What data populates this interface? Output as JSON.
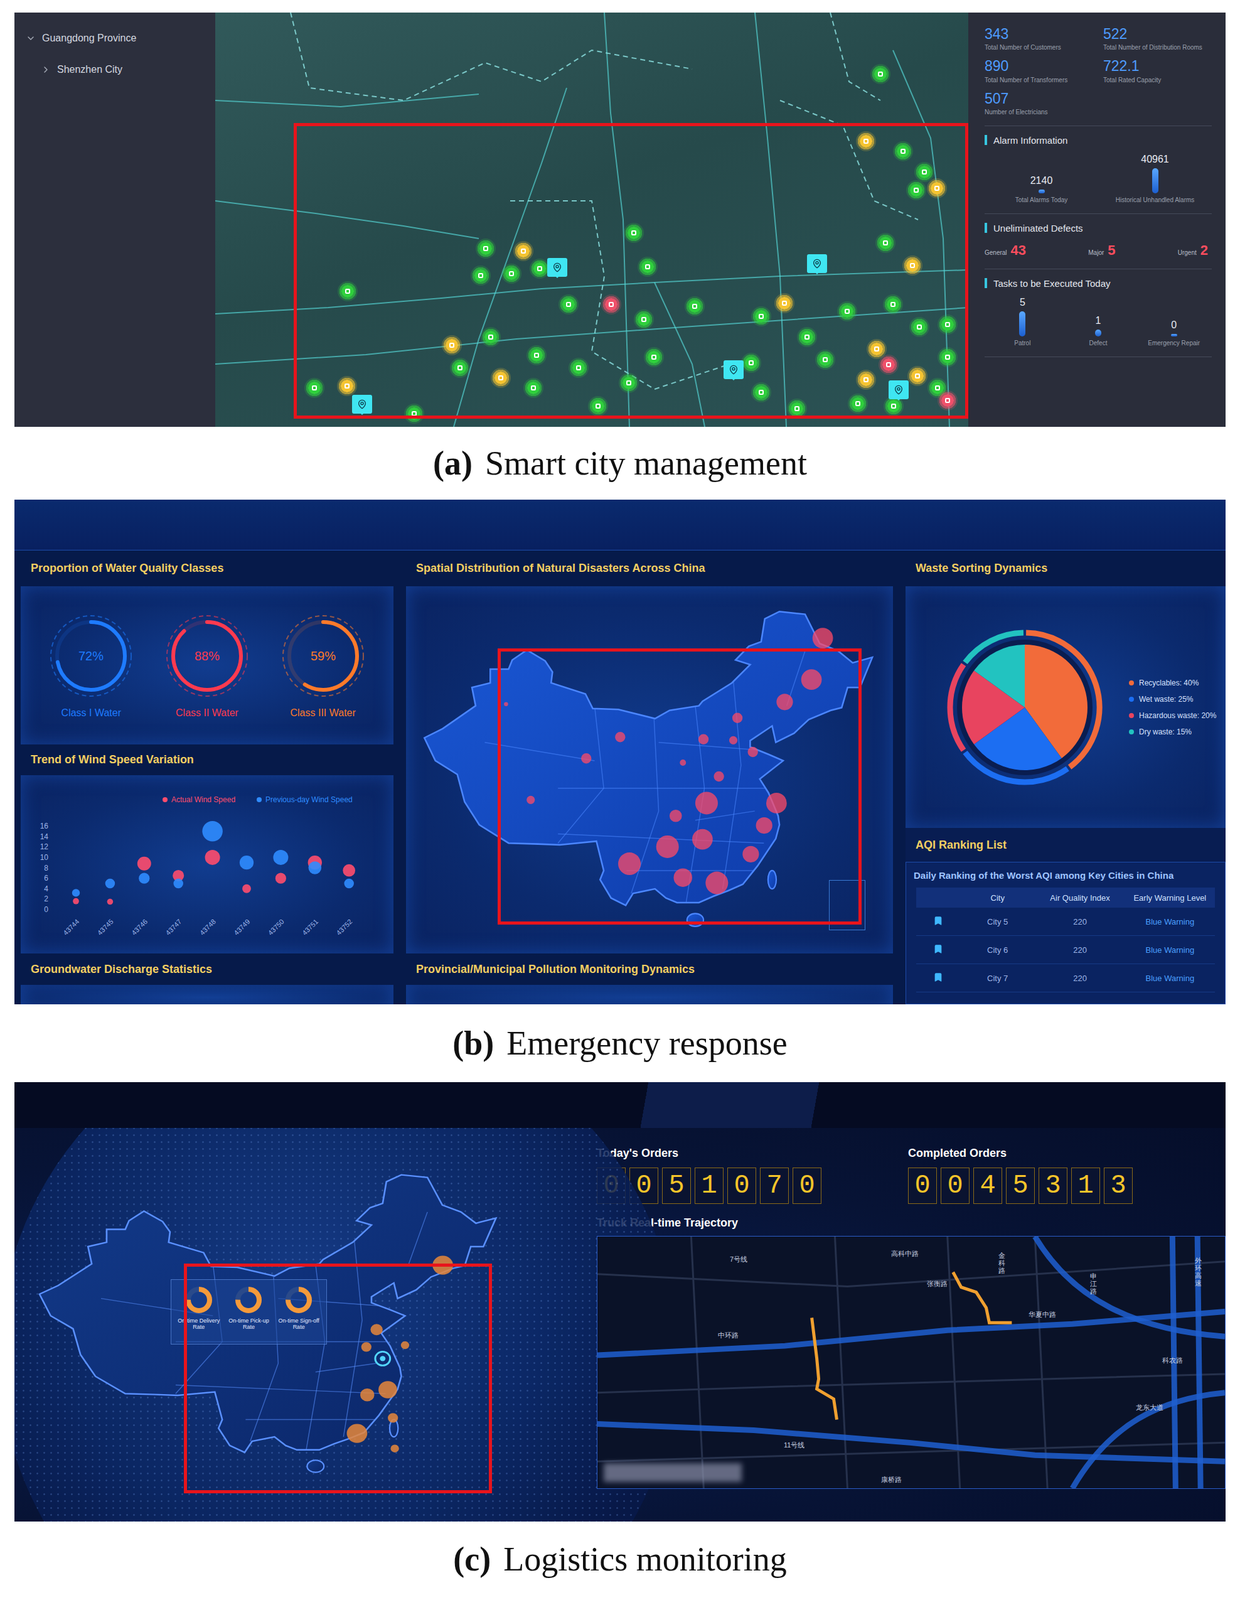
{
  "smart_city": {
    "caption": {
      "label": "(a)",
      "title": "Smart city management"
    },
    "tree": [
      {
        "label": "Guangdong Province",
        "expanded": true,
        "depth": 0
      },
      {
        "label": "Shenzhen City",
        "expanded": false,
        "depth": 1
      }
    ],
    "stats": [
      {
        "value": "343",
        "label": "Total Number of Customers"
      },
      {
        "value": "522",
        "label": "Total Number of Distribution Rooms"
      },
      {
        "value": "890",
        "label": "Total Number of Transformers"
      },
      {
        "value": "722.1",
        "label": "Total Rated Capacity"
      },
      {
        "value": "507",
        "label": "Number of Electricians"
      }
    ],
    "alarms": {
      "title": "Alarm Information",
      "items": [
        {
          "value": "2140",
          "label": "Total Alarms Today",
          "level": 0.05
        },
        {
          "value": "40961",
          "label": "Historical Unhandled Alarms",
          "level": 1
        }
      ]
    },
    "defects": {
      "title": "Uneliminated Defects",
      "items": [
        {
          "label": "General",
          "value": "43"
        },
        {
          "label": "Major",
          "value": "5"
        },
        {
          "label": "Urgent",
          "value": "2"
        }
      ]
    },
    "tasks": {
      "title": "Tasks to be Executed Today",
      "items": [
        {
          "value": "5",
          "label": "Patrol",
          "level": 1
        },
        {
          "value": "1",
          "label": "Defect",
          "level": 0.2
        },
        {
          "value": "0",
          "label": "Emergency Repair",
          "level": 0
        }
      ]
    },
    "markers": [
      {
        "color": "#2fd03c"
      },
      {
        "color": "#2fd03c"
      },
      {
        "color": "#2fd03c"
      },
      {
        "color": "#2fd03c"
      },
      {
        "color": "#2fd03c"
      },
      {
        "color": "#2fd03c"
      },
      {
        "color": "#2fd03c"
      },
      {
        "color": "#2fd03c"
      },
      {
        "color": "#2fd03c"
      },
      {
        "color": "#2fd03c"
      },
      {
        "color": "#2fd03c"
      },
      {
        "color": "#2fd03c"
      },
      {
        "color": "#2fd03c"
      },
      {
        "color": "#2fd03c"
      },
      {
        "color": "#2fd03c"
      },
      {
        "color": "#2fd03c"
      },
      {
        "color": "#2fd03c"
      },
      {
        "color": "#2fd03c"
      },
      {
        "color": "#2fd03c"
      },
      {
        "color": "#2fd03c"
      },
      {
        "color": "#2fd03c"
      },
      {
        "color": "#2fd03c"
      },
      {
        "color": "#2fd03c"
      },
      {
        "color": "#2fd03c"
      },
      {
        "color": "#2fd03c"
      },
      {
        "color": "#2fd03c"
      },
      {
        "color": "#2fd03c"
      },
      {
        "color": "#2fd03c"
      },
      {
        "color": "#2fd03c"
      },
      {
        "color": "#2fd03c"
      },
      {
        "color": "#2fd03c"
      },
      {
        "color": "#2fd03c"
      },
      {
        "color": "#2fd03c"
      },
      {
        "color": "#2fd03c"
      },
      {
        "color": "#2fd03c"
      },
      {
        "color": "#2fd03c"
      },
      {
        "color": "#2fd03c"
      },
      {
        "color": "#2fd03c"
      },
      {
        "color": "#2fd03c"
      },
      {
        "color": "#f5c431"
      },
      {
        "color": "#f5c431"
      },
      {
        "color": "#f5c431"
      },
      {
        "color": "#f5c431"
      },
      {
        "color": "#f5c431"
      },
      {
        "color": "#f5c431"
      },
      {
        "color": "#f5c431"
      },
      {
        "color": "#f5c431"
      },
      {
        "color": "#f5c431"
      },
      {
        "color": "#f5c431"
      },
      {
        "color": "#f5c431"
      },
      {
        "color": "#f0506a"
      },
      {
        "color": "#f0506a"
      },
      {
        "color": "#f0506a"
      }
    ]
  },
  "emergency": {
    "caption": {
      "label": "(b)",
      "title": "Emergency response"
    },
    "water_quality": {
      "title": "Proportion of Water Quality Classes",
      "items": [
        {
          "label": "Class I Water",
          "reading": "72%",
          "level": 0.72,
          "color": "#1e7bff"
        },
        {
          "label": "Class II Water",
          "reading": "88%",
          "level": 0.88,
          "color": "#ff3a4f"
        },
        {
          "label": "Class III Water",
          "reading": "59%",
          "level": 0.59,
          "color": "#ff7a2a"
        }
      ]
    },
    "wind": {
      "title": "Trend of Wind Speed Variation",
      "series": [
        {
          "label": "Actual Wind Speed",
          "color": "#ff4d6d",
          "values": [
            1.6,
            1.5,
            8.8,
            6.5,
            10,
            4,
            6,
            9,
            7.5
          ]
        },
        {
          "label": "Previous-day Wind Speed",
          "color": "#2f8cff",
          "values": [
            3.2,
            5,
            6,
            5,
            15,
            9,
            10,
            8,
            5
          ]
        }
      ],
      "y_ticks": [
        "0",
        "2",
        "4",
        "6",
        "8",
        "10",
        "12",
        "14",
        "16"
      ],
      "x_labels": [
        "43744",
        "43745",
        "43746",
        "43747",
        "43748",
        "43749",
        "43750",
        "43751",
        "43752"
      ]
    },
    "groundwater": {
      "title": "Groundwater Discharge Statistics"
    },
    "disaster_map": {
      "title": "Spatial Distribution of Natural Disasters Across China"
    },
    "pollution": {
      "title": "Provincial/Municipal Pollution Monitoring Dynamics"
    },
    "waste": {
      "title": "Waste Sorting Dynamics",
      "slices": [
        {
          "label": "Recyclables: 40%",
          "value": 40,
          "color": "#f26b3a"
        },
        {
          "label": "Wet waste: 25%",
          "value": 25,
          "color": "#1c6ef2"
        },
        {
          "label": "Hazardous waste: 20%",
          "value": 20,
          "color": "#e8445f"
        },
        {
          "label": "Dry waste: 15%",
          "value": 15,
          "color": "#22c3c0"
        }
      ]
    },
    "aqi": {
      "title": "AQI Ranking List",
      "subtitle": "Daily Ranking of the Worst AQI among Key Cities in China",
      "columns": [
        "City",
        "Air Quality Index",
        "Early Warning Level"
      ],
      "rows": [
        {
          "city": "City 5",
          "aqi": "220",
          "warning": "Blue Warning"
        },
        {
          "city": "City 6",
          "aqi": "220",
          "warning": "Blue Warning"
        },
        {
          "city": "City 7",
          "aqi": "220",
          "warning": "Blue Warning"
        }
      ]
    }
  },
  "logistics": {
    "caption": {
      "label": "(c)",
      "title": "Logistics monitoring"
    },
    "rates": [
      {
        "label": "On-time Delivery Rate",
        "level": 0.75
      },
      {
        "label": "On-time Pick-up Rate",
        "level": 0.75
      },
      {
        "label": "On-time Sign-off Rate",
        "level": 0.75
      }
    ],
    "counters": [
      {
        "label": "Today's Orders",
        "digits": [
          "0",
          "0",
          "5",
          "1",
          "0",
          "7",
          "0"
        ]
      },
      {
        "label": "Completed Orders",
        "digits": [
          "0",
          "0",
          "4",
          "5",
          "3",
          "1",
          "3"
        ]
      }
    ],
    "trajectory": {
      "title": "Truck Real-time Trajectory",
      "road_labels": [
        "7号线",
        "高科中路",
        "金科路",
        "张衡路",
        "中环路",
        "华夏中路",
        "申江路",
        "外环高速",
        "科农路",
        "龙东大道",
        "11号线",
        "康桥路"
      ]
    }
  }
}
